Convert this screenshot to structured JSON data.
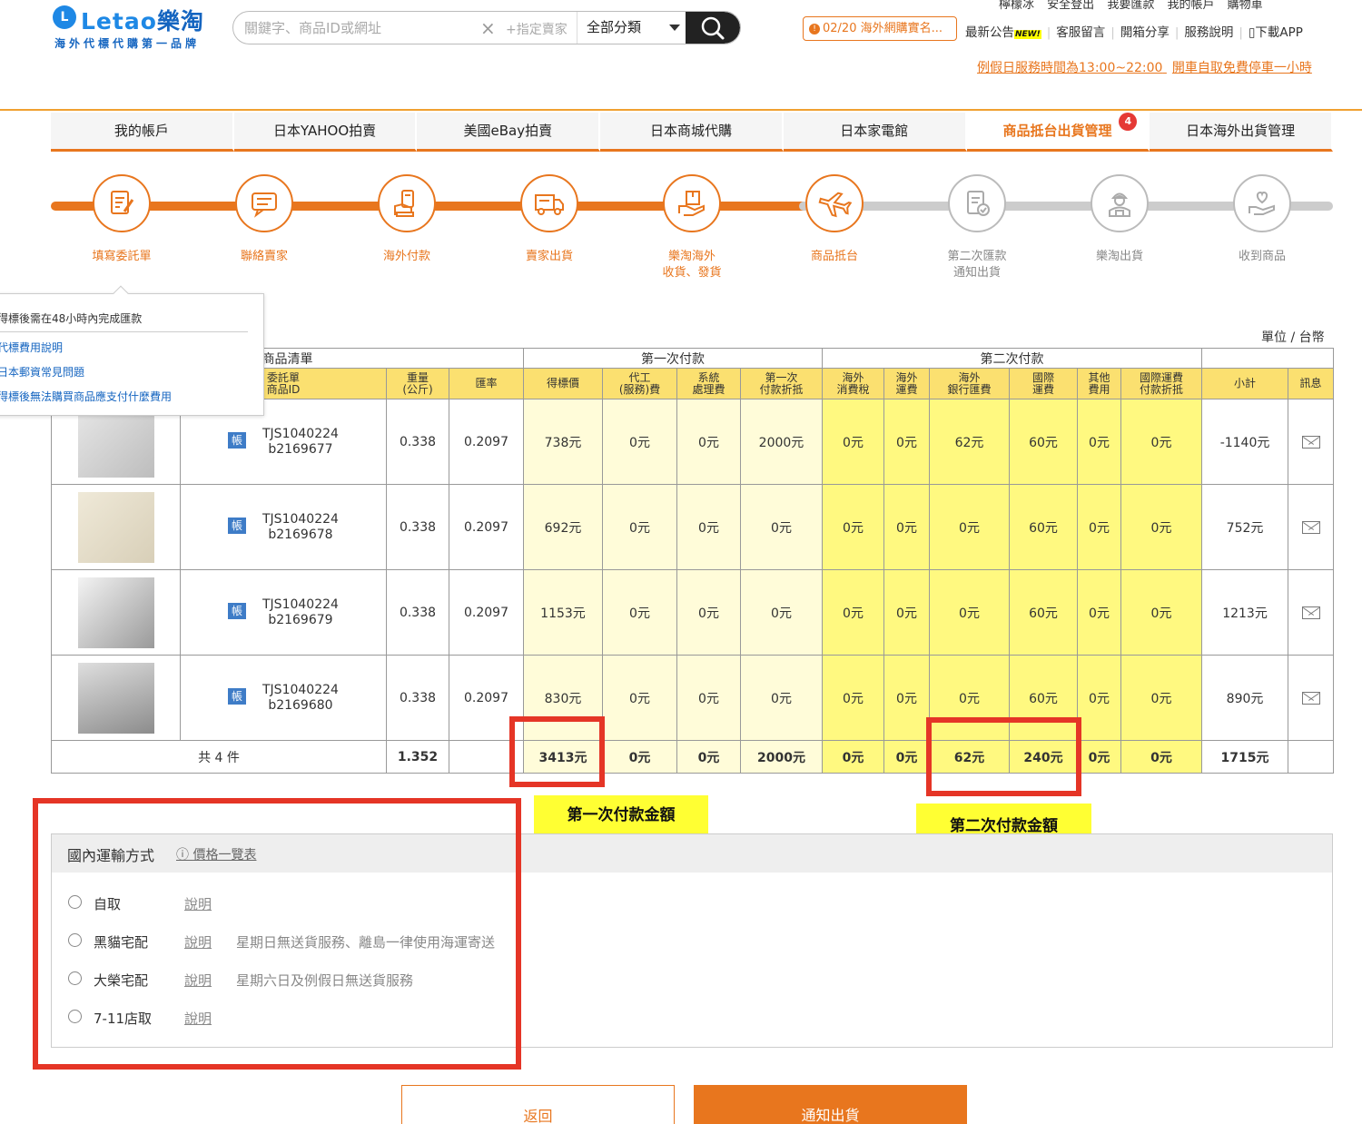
{
  "header": {
    "logo_mark": "L",
    "logo_latin": "Letao",
    "logo_cn": "樂淘",
    "slogan": "海外代標代購第一品牌",
    "search_placeholder": "關鍵字、商品ID或網址",
    "search_seller": "+指定賣家",
    "search_category": "全部分類",
    "top_links": [
      "檸檬冰",
      "安全登出",
      "我要匯款",
      "我的帳戶",
      "購物車"
    ],
    "announcement": "02/20 海外網購實名...",
    "nav_links": [
      "最新公告",
      "客服留言",
      "開箱分享",
      "服務說明",
      "下載APP"
    ],
    "new_badge": "NEW!",
    "holiday_notice": "例假日服務時間為13:00~22:00",
    "parking_notice": "開車自取免費停車一小時"
  },
  "tabs": [
    "我的帳戶",
    "日本YAHOO拍賣",
    "美國eBay拍賣",
    "日本商城代購",
    "日本家電館",
    "商品抵台出貨管理",
    "日本海外出貨管理"
  ],
  "active_tab_badge": "4",
  "steps": [
    {
      "label": "填寫委託單",
      "icon": "form-edit-icon",
      "done": true
    },
    {
      "label": "聯絡賣家",
      "icon": "chat-icon",
      "done": true
    },
    {
      "label": "海外付款",
      "icon": "payment-icon",
      "done": true
    },
    {
      "label": "賣家出貨",
      "icon": "truck-icon",
      "done": true
    },
    {
      "label": "樂淘海外\n收貨、發貨",
      "icon": "package-hand-icon",
      "done": true
    },
    {
      "label": "商品抵台",
      "icon": "airplane-icon",
      "done": true
    },
    {
      "label": "第二次匯款\n通知出貨",
      "icon": "document-check-icon",
      "done": false
    },
    {
      "label": "樂淘出貨",
      "icon": "worker-icon",
      "done": false
    },
    {
      "label": "收到商品",
      "icon": "heart-hand-icon",
      "done": false
    }
  ],
  "popup": {
    "title": "得標後需在48小時內完成匯款",
    "links": [
      "代標費用說明",
      "日本郵資常見問題",
      "得標後無法購買商品應支付什麼費用"
    ]
  },
  "unit_label": "單位 / 台幣",
  "table": {
    "group_headers": {
      "list": "商品清單",
      "first": "第一次付款",
      "second": "第二次付款"
    },
    "columns": [
      "委託單\n商品ID",
      "重量\n(公斤)",
      "匯率",
      "得標價",
      "代工\n(服務)費",
      "系統\n處理費",
      "第一次\n付款折抵",
      "海外\n消費稅",
      "海外\n運費",
      "海外\n銀行匯費",
      "國際\n運費",
      "其他\n費用",
      "國際運費\n付款折抵",
      "小計",
      "訊息"
    ],
    "id_badge": "帳",
    "rows": [
      {
        "id1": "TJS1040224",
        "id2": "b2169677",
        "weight": "0.338",
        "rate": "0.2097",
        "bid": "738元",
        "service": "0元",
        "system": "0元",
        "deduct1": "2000元",
        "tax": "0元",
        "ship_os": "0元",
        "bankfee": "62元",
        "intl": "60元",
        "other": "0元",
        "deduct2": "0元",
        "subtotal": "-1140元"
      },
      {
        "id1": "TJS1040224",
        "id2": "b2169678",
        "weight": "0.338",
        "rate": "0.2097",
        "bid": "692元",
        "service": "0元",
        "system": "0元",
        "deduct1": "0元",
        "tax": "0元",
        "ship_os": "0元",
        "bankfee": "0元",
        "intl": "60元",
        "other": "0元",
        "deduct2": "0元",
        "subtotal": "752元"
      },
      {
        "id1": "TJS1040224",
        "id2": "b2169679",
        "weight": "0.338",
        "rate": "0.2097",
        "bid": "1153元",
        "service": "0元",
        "system": "0元",
        "deduct1": "0元",
        "tax": "0元",
        "ship_os": "0元",
        "bankfee": "0元",
        "intl": "60元",
        "other": "0元",
        "deduct2": "0元",
        "subtotal": "1213元"
      },
      {
        "id1": "TJS1040224",
        "id2": "b2169680",
        "weight": "0.338",
        "rate": "0.2097",
        "bid": "830元",
        "service": "0元",
        "system": "0元",
        "deduct1": "0元",
        "tax": "0元",
        "ship_os": "0元",
        "bankfee": "0元",
        "intl": "60元",
        "other": "0元",
        "deduct2": "0元",
        "subtotal": "890元"
      }
    ],
    "total": {
      "count_label": "共 4 件",
      "weight": "1.352",
      "bid": "3413元",
      "service": "0元",
      "system": "0元",
      "deduct1": "2000元",
      "tax": "0元",
      "ship_os": "0元",
      "bankfee": "62元",
      "intl": "240元",
      "other": "0元",
      "deduct2": "0元",
      "subtotal": "1715元"
    }
  },
  "annotations": {
    "first_payment": "第一次付款金額",
    "second_payment": "第二次付款金額"
  },
  "shipping": {
    "title": "國內運輸方式",
    "price_list": "價格一覽表",
    "options": [
      {
        "name": "自取",
        "desc": "說明",
        "note": ""
      },
      {
        "name": "黑貓宅配",
        "desc": "說明",
        "note": "星期日無送貨服務、離島一律使用海運寄送"
      },
      {
        "name": "大榮宅配",
        "desc": "說明",
        "note": "星期六日及例假日無送貨服務"
      },
      {
        "name": "7-11店取",
        "desc": "說明",
        "note": ""
      }
    ]
  },
  "buttons": {
    "back": "返回",
    "notify": "通知出貨"
  },
  "colors": {
    "accent": "#e8761e",
    "brand": "#1e88e5",
    "highlight_red": "#e53526",
    "highlight_yellow": "#ffff33"
  }
}
